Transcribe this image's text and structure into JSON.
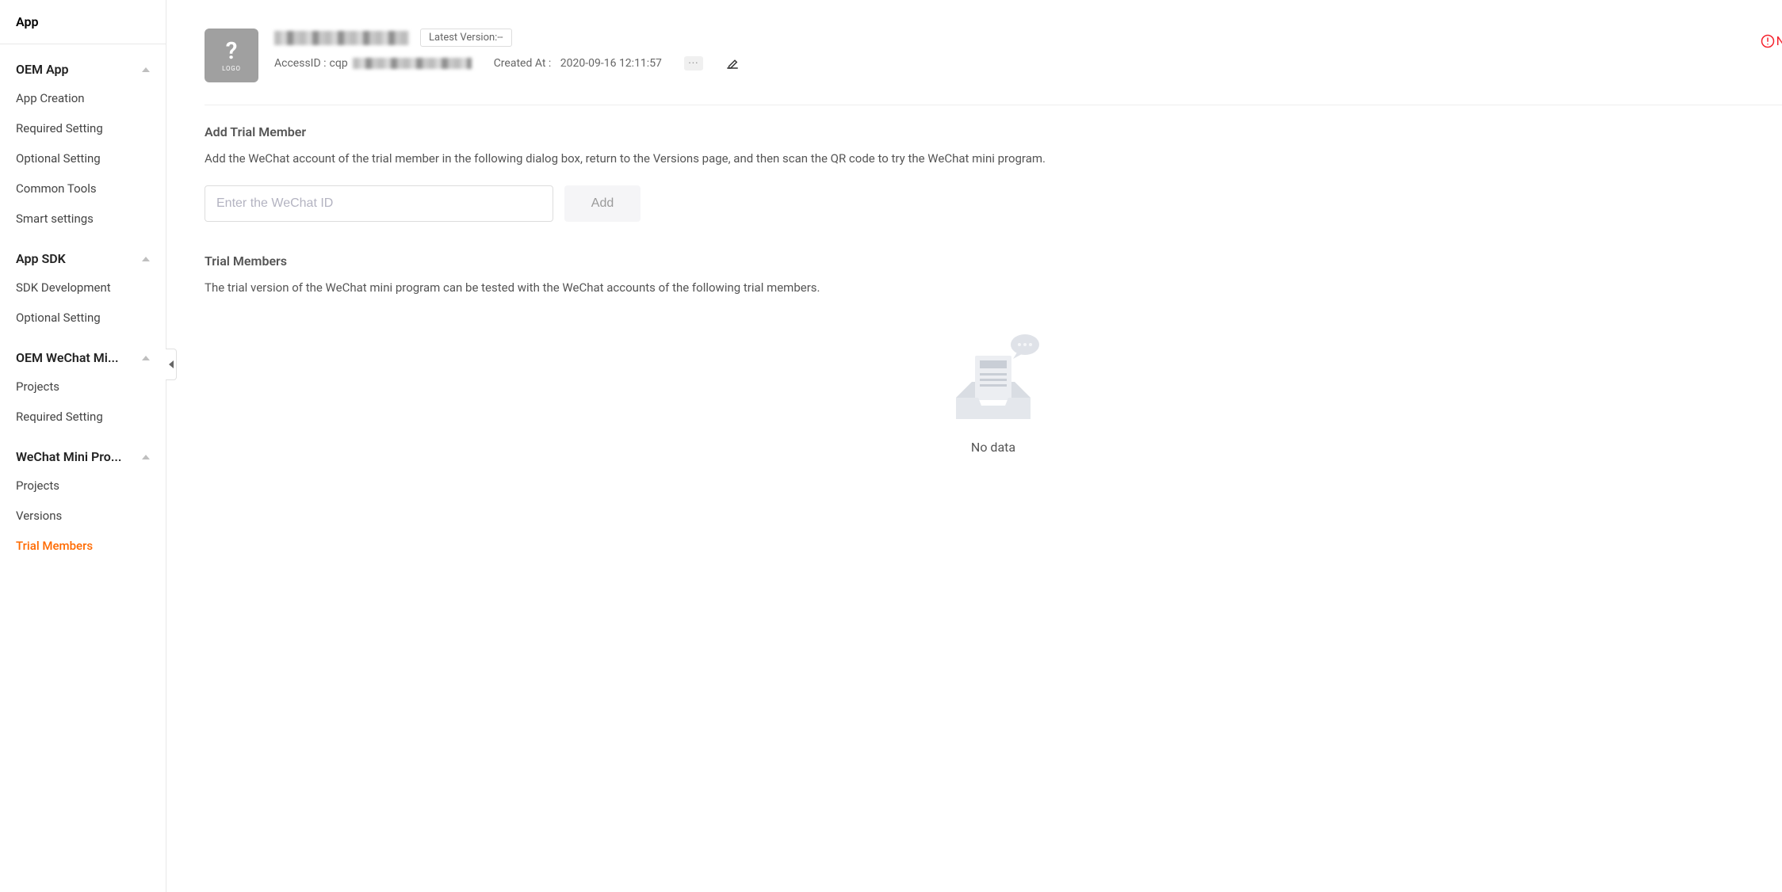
{
  "sidebar": {
    "top_label": "App",
    "sections": [
      {
        "title": "OEM App",
        "items": [
          {
            "label": "App Creation"
          },
          {
            "label": "Required Setting"
          },
          {
            "label": "Optional Setting"
          },
          {
            "label": "Common Tools"
          },
          {
            "label": "Smart settings"
          }
        ]
      },
      {
        "title": "App SDK",
        "items": [
          {
            "label": "SDK Development"
          },
          {
            "label": "Optional Setting"
          }
        ]
      },
      {
        "title": "OEM WeChat Mi...",
        "items": [
          {
            "label": "Projects"
          },
          {
            "label": "Required Setting"
          }
        ]
      },
      {
        "title": "WeChat Mini Pro...",
        "items": [
          {
            "label": "Projects"
          },
          {
            "label": "Versions"
          },
          {
            "label": "Trial Members"
          }
        ]
      }
    ]
  },
  "header": {
    "version_tag": "Latest Version:--",
    "access_id_label": "AccessID :",
    "access_id_value": "cqp",
    "created_at_label": "Created At :",
    "created_at_value": "2020-09-16 12:11:57",
    "alert_letter": "N"
  },
  "add_member": {
    "title": "Add Trial Member",
    "desc": "Add the WeChat account of the trial member in the following dialog box, return to the Versions page, and then scan the QR code to try the WeChat mini program.",
    "placeholder": "Enter the WeChat ID",
    "button": "Add"
  },
  "trial_members": {
    "title": "Trial Members",
    "desc": "The trial version of the WeChat mini program can be tested with the WeChat accounts of the following trial members.",
    "empty_text": "No data"
  }
}
